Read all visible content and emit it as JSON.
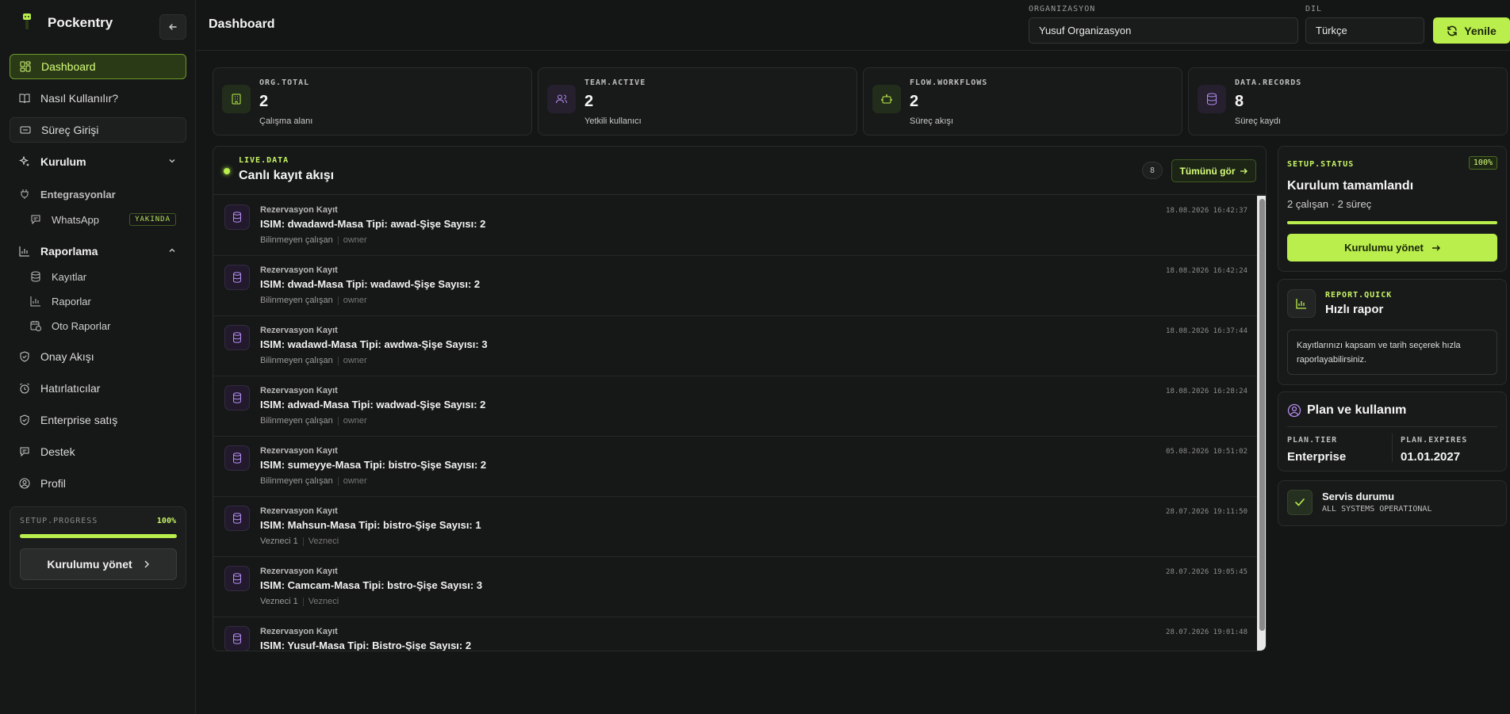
{
  "brand": {
    "name": "Pockentry"
  },
  "sidebar": {
    "items": [
      {
        "label": "Dashboard",
        "icon": "dashboard-icon"
      },
      {
        "label": "Nasıl Kullanılır?",
        "icon": "book-icon"
      },
      {
        "label": "Süreç Girişi",
        "icon": "form-icon"
      },
      {
        "label": "Kurulum",
        "icon": "sparkle-icon"
      },
      {
        "label": "Entegrasyonlar",
        "icon": "plug-icon"
      },
      {
        "label": "WhatsApp",
        "icon": "chat-icon",
        "badge": "YAKINDA"
      },
      {
        "label": "Raporlama",
        "icon": "bar-chart-icon"
      },
      {
        "label": "Kayıtlar",
        "icon": "database-icon"
      },
      {
        "label": "Raporlar",
        "icon": "bar-chart-icon"
      },
      {
        "label": "Oto Raporlar",
        "icon": "calendar-clock-icon"
      },
      {
        "label": "Onay Akışı",
        "icon": "shield-check-icon"
      },
      {
        "label": "Hatırlatıcılar",
        "icon": "alarm-icon"
      },
      {
        "label": "Enterprise satış",
        "icon": "shield-check-icon"
      },
      {
        "label": "Destek",
        "icon": "message-icon"
      },
      {
        "label": "Profil",
        "icon": "user-circle-icon"
      }
    ],
    "setup": {
      "label": "SETUP.PROGRESS",
      "percent": "100%",
      "progress": 1.0,
      "button": "Kurulumu yönet"
    }
  },
  "header": {
    "title": "Dashboard",
    "org_label": "ORGANIZASYON",
    "org_value": "Yusuf Organizasyon",
    "lang_label": "DIL",
    "lang_value": "Türkçe",
    "refresh_label": "Yenile"
  },
  "stats": [
    {
      "key": "ORG.TOTAL",
      "value": "2",
      "sub": "Çalışma alanı",
      "icon": "building-icon"
    },
    {
      "key": "TEAM.ACTIVE",
      "value": "2",
      "sub": "Yetkili kullanıcı",
      "icon": "users-icon"
    },
    {
      "key": "FLOW.WORKFLOWS",
      "value": "2",
      "sub": "Süreç akışı",
      "icon": "bot-icon"
    },
    {
      "key": "DATA.RECORDS",
      "value": "8",
      "sub": "Süreç kaydı",
      "icon": "database-icon"
    }
  ],
  "feed": {
    "key": "LIVE.DATA",
    "title": "Canlı kayıt akışı",
    "count": "8",
    "see_all": "Tümünü gör",
    "rows": [
      {
        "type": "Rezervasyon Kayıt",
        "title": "ISIM: dwadawd-Masa Tipi: awad-Şişe Sayısı: 2",
        "user": "Bilinmeyen çalışan",
        "role": "owner",
        "time": "18.08.2026 16:42:37"
      },
      {
        "type": "Rezervasyon Kayıt",
        "title": "ISIM: dwad-Masa Tipi: wadawd-Şişe Sayısı: 2",
        "user": "Bilinmeyen çalışan",
        "role": "owner",
        "time": "18.08.2026 16:42:24"
      },
      {
        "type": "Rezervasyon Kayıt",
        "title": "ISIM: wadawd-Masa Tipi: awdwa-Şişe Sayısı: 3",
        "user": "Bilinmeyen çalışan",
        "role": "owner",
        "time": "18.08.2026 16:37:44"
      },
      {
        "type": "Rezervasyon Kayıt",
        "title": "ISIM: adwad-Masa Tipi: wadwad-Şişe Sayısı: 2",
        "user": "Bilinmeyen çalışan",
        "role": "owner",
        "time": "18.08.2026 16:28:24"
      },
      {
        "type": "Rezervasyon Kayıt",
        "title": "ISIM: sumeyye-Masa Tipi: bistro-Şişe Sayısı: 2",
        "user": "Bilinmeyen çalışan",
        "role": "owner",
        "time": "05.08.2026 10:51:02"
      },
      {
        "type": "Rezervasyon Kayıt",
        "title": "ISIM: Mahsun-Masa Tipi: bistro-Şişe Sayısı: 1",
        "user": "Vezneci 1",
        "role": "Vezneci",
        "time": "28.07.2026 19:11:50"
      },
      {
        "type": "Rezervasyon Kayıt",
        "title": "ISIM: Camcam-Masa Tipi: bstro-Şişe Sayısı: 3",
        "user": "Vezneci 1",
        "role": "Vezneci",
        "time": "28.07.2026 19:05:45"
      },
      {
        "type": "Rezervasyon Kayıt",
        "title": "ISIM: Yusuf-Masa Tipi: Bistro-Şişe Sayısı: 2",
        "user": "",
        "role": "",
        "time": "28.07.2026 19:01:48"
      }
    ]
  },
  "setup_status": {
    "key": "SETUP.STATUS",
    "percent": "100%",
    "progress": 1.0,
    "title": "Kurulum tamamlandı",
    "sub": "2 çalışan · 2 süreç",
    "button": "Kurulumu yönet"
  },
  "quick_report": {
    "key": "REPORT.QUICK",
    "title": "Hızlı rapor",
    "desc": "Kayıtlarınızı kapsam ve tarih seçerek hızla raporlayabilirsiniz."
  },
  "plan": {
    "title": "Plan ve kullanım",
    "tier_label": "PLAN.TIER",
    "tier_value": "Enterprise",
    "expires_label": "PLAN.EXPIRES",
    "expires_value": "01.01.2027"
  },
  "service": {
    "title": "Servis durumu",
    "status": "ALL SYSTEMS OPERATIONAL"
  },
  "colors": {
    "accent": "#b9ee4c",
    "background": "#141515",
    "card": "#181a19",
    "icon_purple": "#b48cf0"
  }
}
